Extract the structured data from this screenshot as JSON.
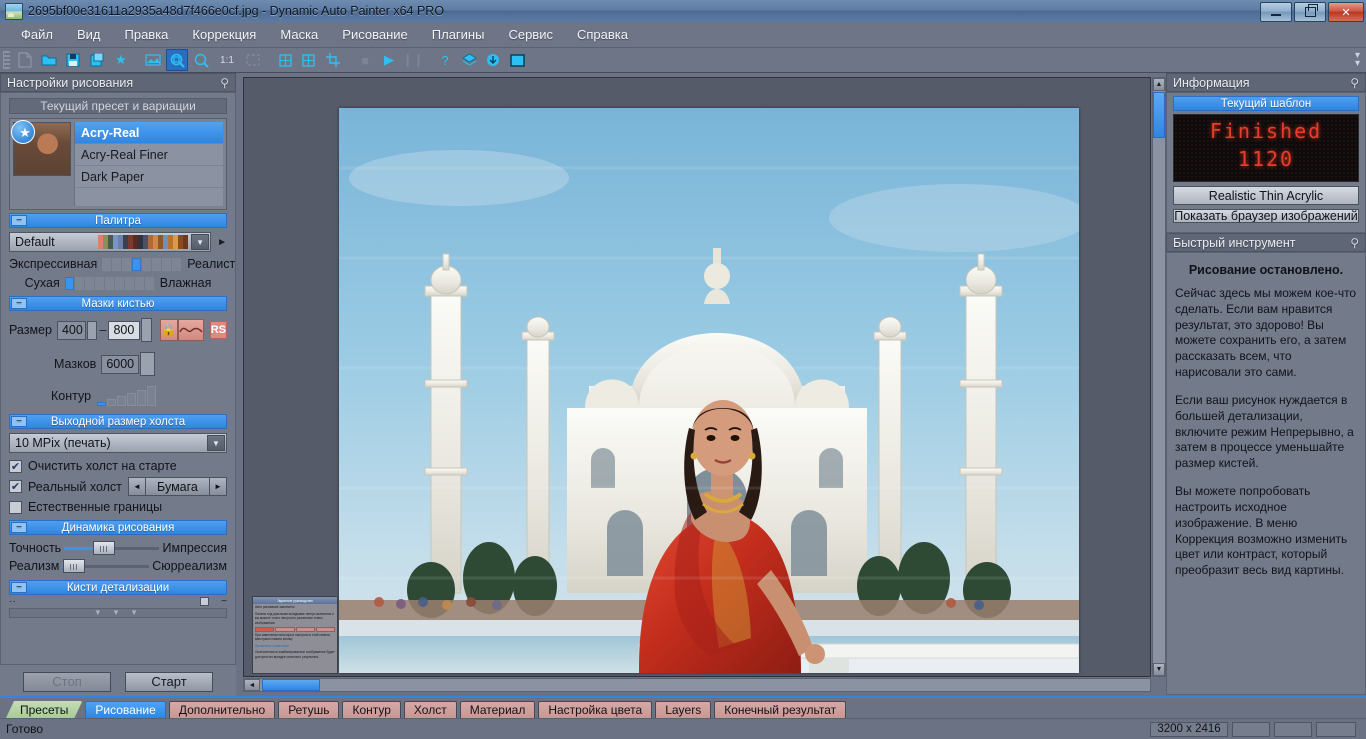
{
  "window": {
    "title": "2695bf00e31611a2935a48d7f466e0cf.jpg - Dynamic Auto Painter x64 PRO",
    "icon": "app-image-icon",
    "minimize_label": "—",
    "restore_label": "❐",
    "close_label": "✕"
  },
  "menu": {
    "items": [
      {
        "label": "Файл"
      },
      {
        "label": "Вид"
      },
      {
        "label": "Правка"
      },
      {
        "label": "Коррекция"
      },
      {
        "label": "Маска"
      },
      {
        "label": "Рисование"
      },
      {
        "label": "Плагины"
      },
      {
        "label": "Сервис"
      },
      {
        "label": "Справка"
      }
    ]
  },
  "toolbar": {
    "zoom_ratio_label": "1:1",
    "items": [
      {
        "name": "new-document-icon",
        "glyph": "🗋",
        "state": "dim"
      },
      {
        "name": "open-folder-icon",
        "glyph": "📂",
        "state": "normal"
      },
      {
        "name": "save-icon",
        "glyph": "💾",
        "state": "normal"
      },
      {
        "name": "save-as-icon",
        "glyph": "🖫",
        "state": "normal"
      },
      {
        "name": "favorite-star-icon",
        "glyph": "★",
        "state": "normal"
      },
      {
        "name": "image-adjust-icon",
        "glyph": "🖼",
        "state": "normal"
      },
      {
        "name": "zoom-fit-icon",
        "glyph": "🔍",
        "state": "selected"
      },
      {
        "name": "zoom-out-icon",
        "glyph": "🔍",
        "state": "normal"
      },
      {
        "name": "zoom-one-to-one-label",
        "glyph": "1:1",
        "state": "label"
      },
      {
        "name": "selection-icon",
        "glyph": "⬚",
        "state": "dim"
      },
      {
        "name": "layout-left-icon",
        "glyph": "◫",
        "state": "normal"
      },
      {
        "name": "layout-right-icon",
        "glyph": "◫",
        "state": "normal"
      },
      {
        "name": "crop-icon",
        "glyph": "⌗",
        "state": "normal"
      },
      {
        "name": "stop-icon",
        "glyph": "■",
        "state": "dim"
      },
      {
        "name": "play-icon",
        "glyph": "▶",
        "state": "normal"
      },
      {
        "name": "pause-icon",
        "glyph": "❙❙",
        "state": "dim"
      },
      {
        "name": "help-icon",
        "glyph": "?",
        "state": "normal"
      },
      {
        "name": "layers-icon",
        "glyph": "◈",
        "state": "normal"
      },
      {
        "name": "download-icon",
        "glyph": "⬇",
        "state": "normal"
      },
      {
        "name": "canvas-icon",
        "glyph": "▣",
        "state": "normal"
      }
    ]
  },
  "left_panel": {
    "title": "Настройки рисования",
    "pin_icon": "pin-icon",
    "preset_section": {
      "header": "Текущий пресет и вариации",
      "thumbnail_badge": "star-icon",
      "items": [
        {
          "label": "Acry-Real",
          "selected": true
        },
        {
          "label": "Acry-Real Finer",
          "selected": false
        },
        {
          "label": "Dark Paper",
          "selected": false
        }
      ]
    },
    "palette_section": {
      "header": "Палитра",
      "collapse_glyph": "−",
      "selected_palette": "Default",
      "swatch_colors": [
        "#d8836a",
        "#8a8f5c",
        "#4a5a4e",
        "#7596c4",
        "#6e7fa8",
        "#3a3f52",
        "#7a3b2e",
        "#5a2a22",
        "#2e3344",
        "#4a5166",
        "#b06a3a",
        "#d0884a",
        "#8a5a2e",
        "#6f8fbc",
        "#b8742f",
        "#d99b4a",
        "#8a4a22",
        "#6a3a1e"
      ],
      "sliders": [
        {
          "left_label": "Экспрессивная",
          "right_label": "Реалистичная",
          "ticks": 8,
          "active_index": 3
        },
        {
          "left_label": "Сухая",
          "right_label": "Влажная",
          "ticks": 9,
          "active_index": 0
        }
      ]
    },
    "brush_strokes_section": {
      "header": "Мазки кистью",
      "collapse_glyph": "−",
      "size_label": "Размер",
      "size_min": "400",
      "size_max": "800",
      "lock_icon": "lock-icon",
      "curve_icon": "wave-curve-icon",
      "rs_label": "RS",
      "strokes_label": "Мазков",
      "strokes_value": "6000",
      "contour_label": "Контур"
    },
    "canvas_size_section": {
      "header": "Выходной размер холста",
      "collapse_glyph": "−",
      "selected_size": "10 MPix (печать)",
      "checkboxes": [
        {
          "label": "Очистить холст на старте",
          "checked": true
        },
        {
          "label": "Реальный холст",
          "checked": true
        },
        {
          "label": "Естественные границы",
          "checked": false
        }
      ],
      "material_value": "Бумага",
      "prev_glyph": "◄",
      "next_glyph": "►"
    },
    "dynamics_section": {
      "header": "Динамика рисования",
      "collapse_glyph": "−",
      "sliders": [
        {
          "left_label": "Точность",
          "right_label": "Импрессия",
          "percent": 34
        },
        {
          "left_label": "Реализм",
          "right_label": "Сюрреализм",
          "percent": 6
        }
      ]
    },
    "detail_brushes_section": {
      "header": "Кисти детализации",
      "collapse_glyph": "−"
    },
    "scroll_hint": "▼ ▼ ▼",
    "buttons": {
      "stop_label": "Стоп",
      "start_label": "Старт"
    }
  },
  "right_panel": {
    "title": "Информация",
    "pin_icon": "pin-icon",
    "current_template_header": "Текущий шаблон",
    "led_line1": "Finished",
    "led_line2": "1120",
    "led_color": "#e83c2c",
    "template_name_button": "Realistic Thin Acrylic",
    "image_browser_button": "Показать браузер изображений"
  },
  "quick_tool_panel": {
    "title": "Быстрый инструмент",
    "pin_icon": "pin-icon",
    "heading": "Рисование остановлено.",
    "paragraphs": [
      "Сейчас здесь мы можем кое-что сделать. Если вам нравится результат, это здорово! Вы можете сохранить его, а затем рассказать всем, что нарисовали это сами.",
      "Если ваш рисунок нуждается в большей детализации, включите режим Непрерывно, а затем в процессе уменьшайте размер кистей.",
      "Вы можете попробовать настроить исходное изображение. В меню Коррекция возможно изменить цвет или контраст, который преобразит весь вид картины."
    ]
  },
  "guide_popup": {
    "title": "Экранное руководство",
    "close_glyph": "×",
    "line1": "Авто рисование закончено",
    "line2": "Панели под красными вкладками теперь включены и вы можете точно настроить различные этапы изображения.",
    "tabs": [
      "Контур",
      "Холст",
      "Материал",
      "Настр."
    ],
    "line3": "При изменении некоторых настроек в этой панели, вам нужно нажать кнопку",
    "link": "Применить к живописи",
    "line4": "Окончательное комбинированное изображение будет доступно во вкладке конечного результата."
  },
  "bottom_tabs": [
    {
      "label": "Пресеты",
      "style": "green"
    },
    {
      "label": "Рисование",
      "style": "blue"
    },
    {
      "label": "Дополнительно",
      "style": "rose"
    },
    {
      "label": "Ретушь",
      "style": "rose"
    },
    {
      "label": "Контур",
      "style": "rose"
    },
    {
      "label": "Холст",
      "style": "rose"
    },
    {
      "label": "Материал",
      "style": "rose"
    },
    {
      "label": "Настройка цвета",
      "style": "rose"
    },
    {
      "label": "Layers",
      "style": "rose"
    },
    {
      "label": "Конечный результат",
      "style": "rose"
    }
  ],
  "status_bar": {
    "message": "Готово",
    "dimensions": "3200 x 2416",
    "field2": "",
    "field3": "",
    "field4": ""
  },
  "canvas": {
    "description": "Painted artwork: woman in red sari seated before the Taj Mahal"
  }
}
